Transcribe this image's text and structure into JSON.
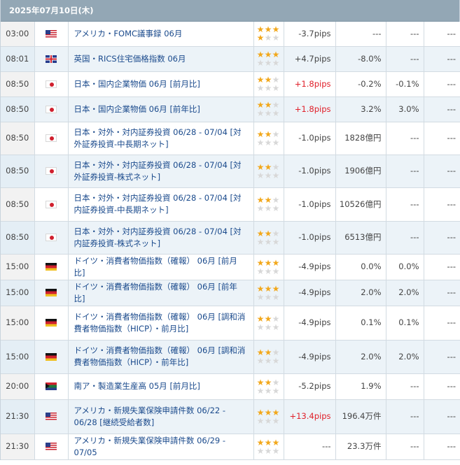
{
  "header": {
    "date": "2025年07月10日(木)"
  },
  "colors": {
    "header_bg": "#93a7b5",
    "star_on": "#f2a81c",
    "star_off": "#d8d8d8",
    "link": "#1a4a8c",
    "positive": "#e0202a"
  },
  "rows": [
    {
      "time": "03:00",
      "flag": "us",
      "flag_icon": "us-flag-icon",
      "name": "アメリカ・FOMC議事録 06月",
      "stars": 4,
      "impact": "-3.7pips",
      "actual": "---",
      "forecast": "---",
      "previous": "---"
    },
    {
      "time": "08:01",
      "flag": "uk",
      "flag_icon": "uk-flag-icon",
      "name": "英国・RICS住宅価格指数 06月",
      "stars": 3,
      "impact": "+4.7pips",
      "actual": "-8.0%",
      "forecast": "---",
      "previous": "---"
    },
    {
      "time": "08:50",
      "flag": "jp",
      "flag_icon": "jp-flag-icon",
      "name": "日本・国内企業物価 06月 [前月比]",
      "stars": 2,
      "impact": "+1.8pips",
      "actual": "-0.2%",
      "forecast": "-0.1%",
      "previous": "---"
    },
    {
      "time": "08:50",
      "flag": "jp",
      "flag_icon": "jp-flag-icon",
      "name": "日本・国内企業物価 06月 [前年比]",
      "stars": 2,
      "impact": "+1.8pips",
      "actual": "3.2%",
      "forecast": "3.0%",
      "previous": "---"
    },
    {
      "time": "08:50",
      "flag": "jp",
      "flag_icon": "jp-flag-icon",
      "name": "日本・対外・対内証券投資 06/28 - 07/04 [対外証券投資-中長期ネット]",
      "stars": 2,
      "impact": "-1.0pips",
      "actual": "1828億円",
      "forecast": "---",
      "previous": "---"
    },
    {
      "time": "08:50",
      "flag": "jp",
      "flag_icon": "jp-flag-icon",
      "name": "日本・対外・対内証券投資 06/28 - 07/04 [対外証券投資-株式ネット]",
      "stars": 2,
      "impact": "-1.0pips",
      "actual": "1906億円",
      "forecast": "---",
      "previous": "---"
    },
    {
      "time": "08:50",
      "flag": "jp",
      "flag_icon": "jp-flag-icon",
      "name": "日本・対外・対内証券投資 06/28 - 07/04 [対内証券投資-中長期ネット]",
      "stars": 2,
      "impact": "-1.0pips",
      "actual": "10526億円",
      "forecast": "---",
      "previous": "---"
    },
    {
      "time": "08:50",
      "flag": "jp",
      "flag_icon": "jp-flag-icon",
      "name": "日本・対外・対内証券投資 06/28 - 07/04 [対内証券投資-株式ネット]",
      "stars": 2,
      "impact": "-1.0pips",
      "actual": "6513億円",
      "forecast": "---",
      "previous": "---"
    },
    {
      "time": "15:00",
      "flag": "de",
      "flag_icon": "de-flag-icon",
      "name": "ドイツ・消費者物価指数（確報） 06月 [前月比]",
      "stars": 3,
      "impact": "-4.9pips",
      "actual": "0.0%",
      "forecast": "0.0%",
      "previous": "---"
    },
    {
      "time": "15:00",
      "flag": "de",
      "flag_icon": "de-flag-icon",
      "name": "ドイツ・消費者物価指数（確報） 06月 [前年比]",
      "stars": 3,
      "impact": "-4.9pips",
      "actual": "2.0%",
      "forecast": "2.0%",
      "previous": "---"
    },
    {
      "time": "15:00",
      "flag": "de",
      "flag_icon": "de-flag-icon",
      "name": "ドイツ・消費者物価指数（確報） 06月 [調和消費者物価指数（HICP）・前月比]",
      "stars": 2,
      "impact": "-4.9pips",
      "actual": "0.1%",
      "forecast": "0.1%",
      "previous": "---"
    },
    {
      "time": "15:00",
      "flag": "de",
      "flag_icon": "de-flag-icon",
      "name": "ドイツ・消費者物価指数（確報） 06月 [調和消費者物価指数（HICP）・前年比]",
      "stars": 2,
      "impact": "-4.9pips",
      "actual": "2.0%",
      "forecast": "2.0%",
      "previous": "---"
    },
    {
      "time": "20:00",
      "flag": "za",
      "flag_icon": "za-flag-icon",
      "name": "南ア・製造業生産高 05月 [前月比]",
      "stars": 2,
      "impact": "-5.2pips",
      "actual": "1.9%",
      "forecast": "---",
      "previous": "---"
    },
    {
      "time": "21:30",
      "flag": "us",
      "flag_icon": "us-flag-icon",
      "name": "アメリカ・新規失業保険申請件数 06/22 - 06/28 [継続受給者数]",
      "stars": 3,
      "impact": "+13.4pips",
      "actual": "196.4万件",
      "forecast": "---",
      "previous": "---"
    },
    {
      "time": "21:30",
      "flag": "us",
      "flag_icon": "us-flag-icon",
      "name": "アメリカ・新規失業保険申請件数 06/29 - 07/05",
      "stars": 3,
      "impact": "---",
      "actual": "23.3万件",
      "forecast": "---",
      "previous": "---"
    }
  ]
}
